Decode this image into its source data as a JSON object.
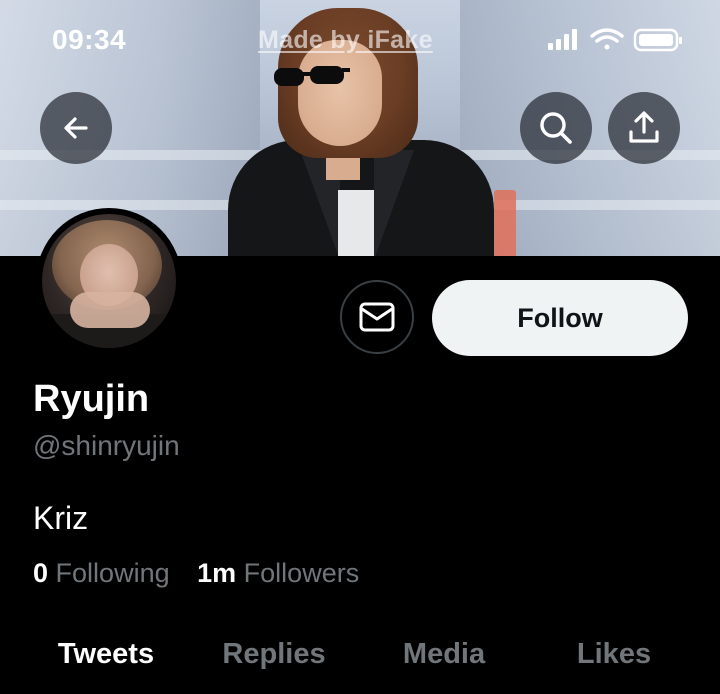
{
  "status_bar": {
    "time": "09:34",
    "watermark": "Made by iFake"
  },
  "header": {
    "back_icon": "arrow-left-icon",
    "search_icon": "search-icon",
    "share_icon": "share-upload-icon"
  },
  "profile": {
    "name": "Ryujin",
    "handle": "@shinryujin",
    "bio": "Kriz",
    "following_count": "0",
    "following_label": "Following",
    "followers_count": "1m",
    "followers_label": "Followers"
  },
  "actions": {
    "message_icon": "envelope-icon",
    "follow_label": "Follow"
  },
  "tabs": [
    {
      "label": "Tweets",
      "active": true
    },
    {
      "label": "Replies",
      "active": false
    },
    {
      "label": "Media",
      "active": false
    },
    {
      "label": "Likes",
      "active": false
    }
  ],
  "colors": {
    "background": "#000000",
    "primary_text": "#ffffff",
    "secondary_text": "#71767b",
    "follow_button_bg": "#eff3f4",
    "follow_button_text": "#0f1419"
  }
}
